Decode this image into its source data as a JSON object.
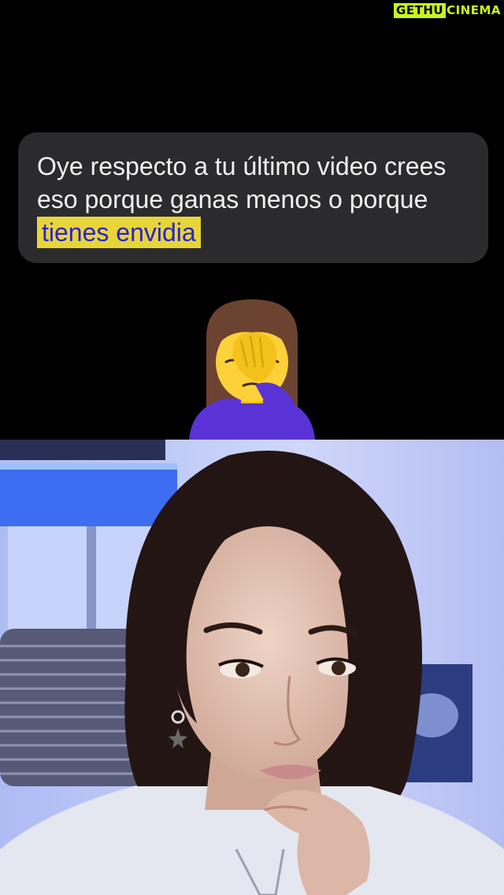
{
  "watermark": {
    "box_text": "GETHU",
    "text": "CINEMA"
  },
  "message": {
    "text_plain": "Oye respecto a tu último video crees eso porque ganas menos o porque",
    "text_highlight": "tienes envidia"
  },
  "emoji": {
    "icon": "woman-facepalming-emoji"
  },
  "colors": {
    "bubble_bg": "#2b2b2d",
    "highlight_bg": "#e7d53a",
    "highlight_text": "#2b22c9",
    "watermark": "#c8f51e"
  }
}
